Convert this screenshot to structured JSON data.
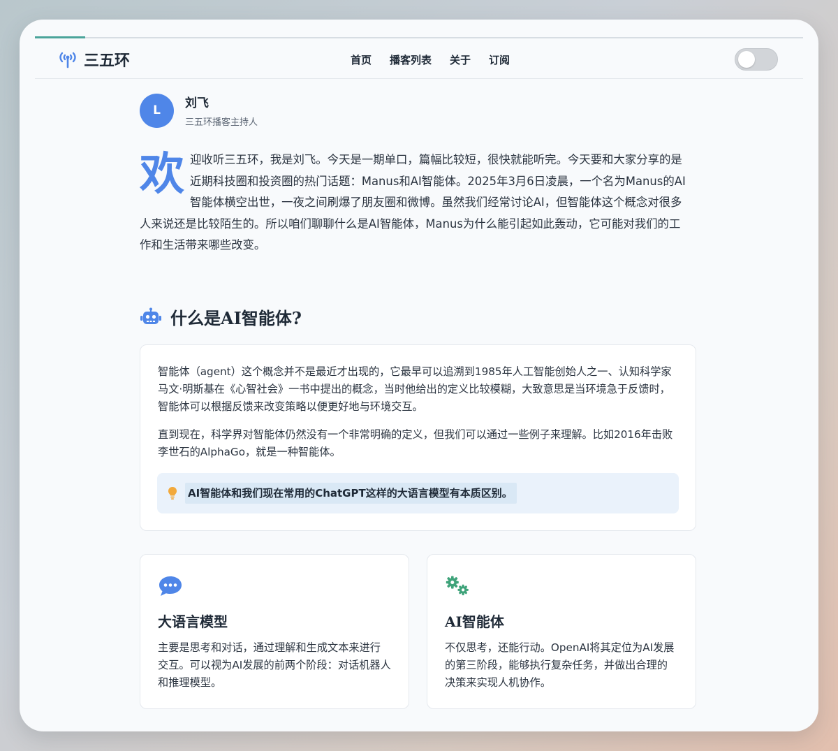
{
  "brand": {
    "name": "三五环"
  },
  "reading_progress": 0.065,
  "nav": {
    "items": [
      {
        "label": "首页"
      },
      {
        "label": "播客列表"
      },
      {
        "label": "关于"
      },
      {
        "label": "订阅"
      }
    ]
  },
  "theme_toggle": {
    "state": "off"
  },
  "author": {
    "initial": "L",
    "name": "刘飞",
    "role": "三五环播客主持人",
    "avatar_color": "#4f86e8"
  },
  "intro": {
    "dropcap": "欢",
    "text": "迎收听三五环，我是刘飞。今天是一期单口，篇幅比较短，很快就能听完。今天要和大家分享的是近期科技圈和投资圈的热门话题：Manus和AI智能体。2025年3月6日凌晨，一个名为Manus的AI智能体横空出世，一夜之间刷爆了朋友圈和微博。虽然我们经常讨论AI，但智能体这个概念对很多人来说还是比较陌生的。所以咱们聊聊什么是AI智能体，Manus为什么能引起如此轰动，它可能对我们的工作和生活带来哪些改变。"
  },
  "section": {
    "icon": "robot-icon",
    "title": "什么是AI智能体?"
  },
  "main_card": {
    "paragraphs": [
      "智能体（agent）这个概念并不是最近才出现的，它最早可以追溯到1985年人工智能创始人之一、认知科学家马文·明斯基在《心智社会》一书中提出的概念，当时他给出的定义比较模糊，大致意思是当环境急于反馈时，智能体可以根据反馈来改变策略以便更好地与环境交互。",
      "直到现在，科学界对智能体仍然没有一个非常明确的定义，但我们可以通过一些例子来理解。比如2016年击败李世石的AlphaGo，就是一种智能体。"
    ],
    "tip": {
      "icon": "lightbulb-icon",
      "text": "AI智能体和我们现在常用的ChatGPT这样的大语言模型有本质区别。"
    }
  },
  "features": [
    {
      "icon": "chat-bubble-icon",
      "icon_color": "#4f86e8",
      "title": "大语言模型",
      "text": "主要是思考和对话，通过理解和生成文本来进行交互。可以视为AI发展的前两个阶段：对话机器人和推理模型。"
    },
    {
      "icon": "gears-icon",
      "icon_color": "#3fa37a",
      "title": "AI智能体",
      "text": "不仅思考，还能行动。OpenAI将其定位为AI发展的第三阶段，能够执行复杂任务，并做出合理的决策来实现人机协作。"
    }
  ],
  "colors": {
    "accent": "#4f86e8",
    "progress": "#4aa49a",
    "tip_bg": "#eaf2fb",
    "bulb": "#f2a93b"
  }
}
